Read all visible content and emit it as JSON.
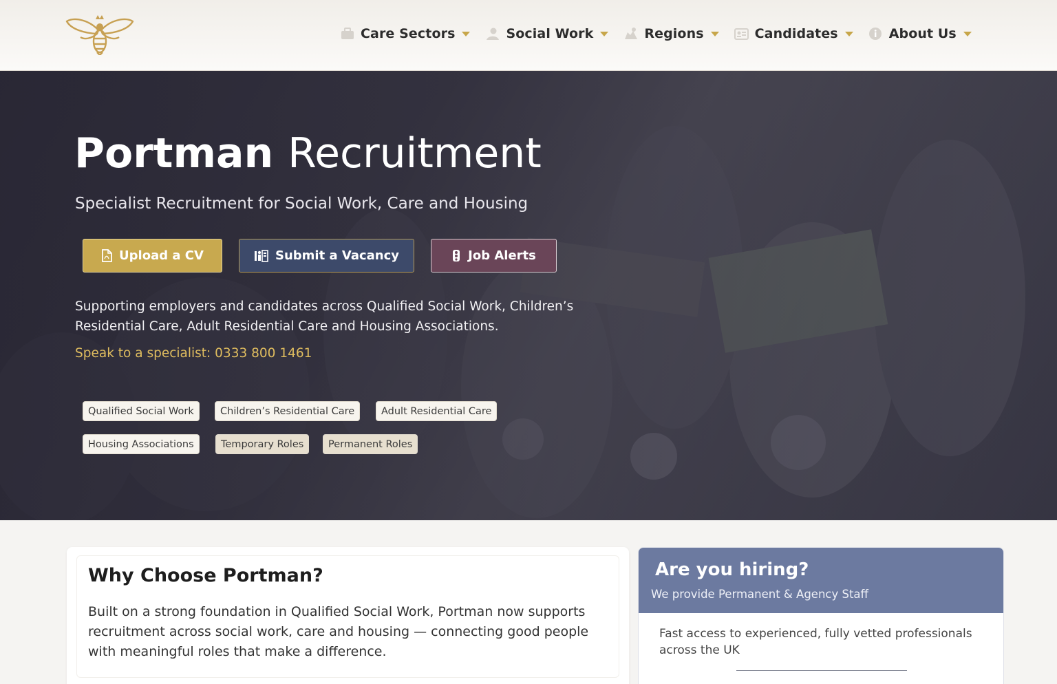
{
  "brand": {
    "logo_icon": "bee-icon",
    "accent_color": "#c8a94f"
  },
  "nav": {
    "items": [
      {
        "label": "Care Sectors",
        "icon": "briefcase-icon"
      },
      {
        "label": "Social Work",
        "icon": "user-icon"
      },
      {
        "label": "Regions",
        "icon": "map-icon"
      },
      {
        "label": "Candidates",
        "icon": "id-card-icon"
      },
      {
        "label": "About Us",
        "icon": "info-icon"
      }
    ]
  },
  "hero": {
    "title_bold": "Portman",
    "title_light": "Recruitment",
    "subtitle": "Specialist Recruitment for Social Work, Care and Housing",
    "buttons": {
      "upload_cv": "Upload a CV",
      "submit_vacancy": "Submit a Vacancy",
      "job_alerts": "Job Alerts"
    },
    "description": "Supporting employers and candidates across Qualified Social Work, Children’s Residential Care, Adult Residential Care and Housing Associations.",
    "phone_text": "Speak to a specialist: 0333 800 1461",
    "tags": [
      "Qualified Social Work",
      "Children’s Residential Care",
      "Adult Residential Care",
      "Housing Associations",
      "Temporary Roles",
      "Permanent Roles"
    ]
  },
  "why": {
    "title_prefix": "Why Choose ",
    "title_bold": "Portman",
    "title_suffix": "?",
    "text": "Built on a strong foundation in Qualified Social Work, Portman now supports recruitment across social work, care and housing — connecting good people with meaningful roles that make a difference."
  },
  "hiring": {
    "title": "Are you hiring?",
    "subtitle": "We provide Permanent & Agency Staff",
    "text": "Fast access to experienced, fully vetted professionals across the UK",
    "header_color": "#6c7aa0"
  }
}
